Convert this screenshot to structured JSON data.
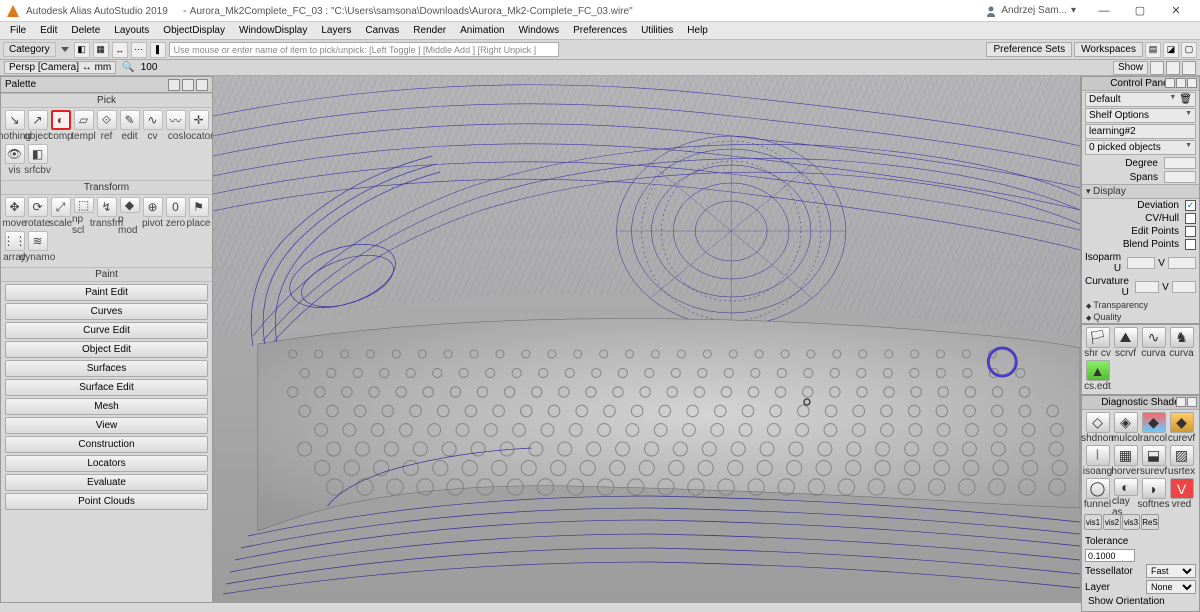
{
  "titlebar": {
    "app": "Autodesk Alias AutoStudio 2019",
    "doc": "Aurora_Mk2Complete_FC_03 : \"C:\\Users\\samsona\\Downloads\\Aurora_Mk2-Complete_FC_03.wire\"",
    "user": "Andrzej Sam..."
  },
  "menus": [
    "File",
    "Edit",
    "Delete",
    "Layouts",
    "ObjectDisplay",
    "WindowDisplay",
    "Layers",
    "Canvas",
    "Render",
    "Animation",
    "Windows",
    "Preferences",
    "Utilities",
    "Help"
  ],
  "toolbar": {
    "category": "Category",
    "promptline": "Use mouse or enter name of item to pick/unpick: [Left Toggle ] [Middle Add ] [Right Unpick ]",
    "right": [
      "Preference Sets",
      "Workspaces"
    ],
    "show": "Show"
  },
  "statusline": {
    "view": "Persp [Camera] ↔ mm",
    "zoom": "100"
  },
  "palette": {
    "title": "Palette",
    "sections": {
      "pick": "Pick",
      "transform": "Transform",
      "paint": "Paint"
    },
    "pick": [
      "nothing",
      "object",
      "comp",
      "templ",
      "ref",
      "edit",
      "cv",
      "cos",
      "locator",
      "vis",
      "srfcbv"
    ],
    "transform": [
      "move",
      "rotate",
      "scale",
      "np scl",
      "transfm",
      "p mod",
      "pivot",
      "zero",
      "place",
      "array",
      "dynamo"
    ],
    "panels": [
      "Paint Edit",
      "Curves",
      "Curve Edit",
      "Object Edit",
      "Surfaces",
      "Surface Edit",
      "Mesh",
      "View",
      "Construction",
      "Locators",
      "Evaluate",
      "Point Clouds"
    ]
  },
  "control": {
    "title": "Control Panel",
    "default": "Default",
    "shelf": "Shelf Options",
    "learning": "learning#2",
    "picked": "0 picked objects",
    "degree": "Degree",
    "spans": "Spans",
    "display": "Display",
    "deviation": "Deviation",
    "cvhull": "CV/Hull",
    "editpoints": "Edit Points",
    "blendpoints": "Blend Points",
    "isoparm": "Isoparm U",
    "curvature": "Curvature U",
    "transparency": "Transparency",
    "quality": "Quality",
    "v": "V"
  },
  "shelficons1": [
    "shr cv",
    "scrvf",
    "curva",
    "curva",
    "cs.edt"
  ],
  "diag": {
    "title": "Diagnostic Shade",
    "icons": [
      "shdnon",
      "mulcol",
      "rancol",
      "curevf",
      "isoang",
      "horver",
      "surevf",
      "usrtex",
      "funnel",
      "clay as",
      "softnes",
      "vred"
    ],
    "vis": [
      "vis1",
      "vis2",
      "vis3",
      "ReS"
    ]
  },
  "bottom": {
    "tolerance": "Tolerance",
    "tol_val": "0.1000",
    "tessellator": "Tessellator",
    "tess_val": "Fast",
    "layer": "Layer",
    "layer_val": "None",
    "orientation": "Show Orientation"
  }
}
